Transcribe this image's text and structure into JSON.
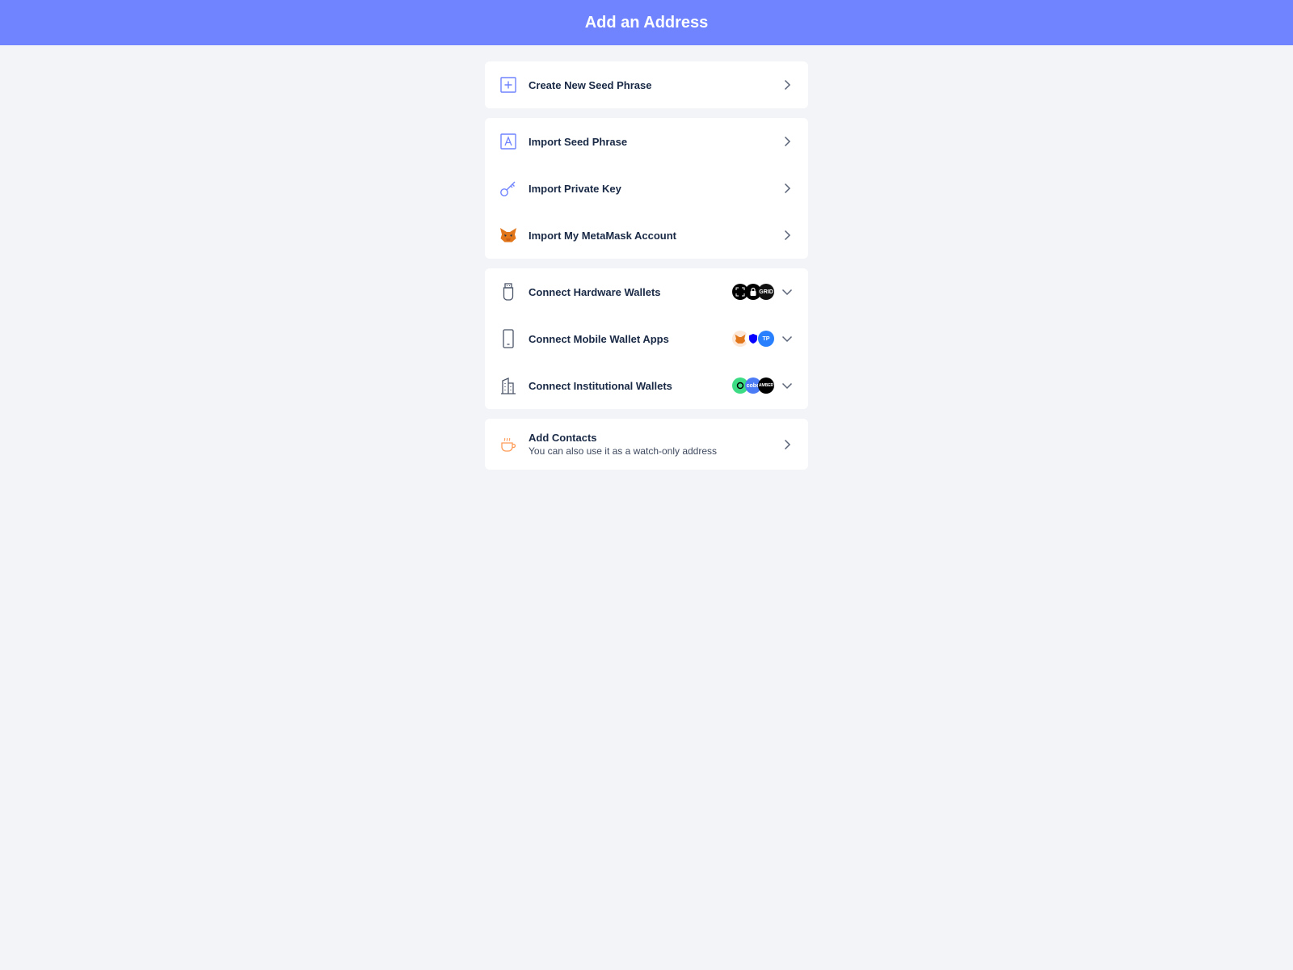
{
  "header": {
    "title": "Add an Address"
  },
  "colors": {
    "accent": "#7084ff",
    "background": "#f2f4f8",
    "text": "#192945",
    "icon_orange": "#ff9b56"
  },
  "groups": [
    {
      "items": [
        {
          "label": "Create New Seed Phrase",
          "icon": "plus-square-icon",
          "action": "chevron-right"
        }
      ]
    },
    {
      "items": [
        {
          "label": "Import Seed Phrase",
          "icon": "letter-a-icon",
          "action": "chevron-right"
        },
        {
          "label": "Import Private Key",
          "icon": "key-icon",
          "action": "chevron-right"
        },
        {
          "label": "Import My MetaMask Account",
          "icon": "metamask-fox-icon",
          "action": "chevron-right"
        }
      ]
    },
    {
      "items": [
        {
          "label": "Connect Hardware Wallets",
          "icon": "usb-device-icon",
          "action": "chevron-down",
          "logos": [
            {
              "icon": "ledger-logo",
              "color": "#000000",
              "text": ""
            },
            {
              "icon": "lock-logo",
              "color": "#000000",
              "text": ""
            },
            {
              "icon": "gridplus-logo",
              "color": "#111111",
              "text": "GRID"
            }
          ]
        },
        {
          "label": "Connect Mobile Wallet Apps",
          "icon": "smartphone-icon",
          "action": "chevron-down",
          "logos": [
            {
              "icon": "metamask-logo",
              "color": "#fde8d7",
              "text": ""
            },
            {
              "icon": "trust-shield-logo",
              "color": "#ffffff",
              "text": ""
            },
            {
              "icon": "tokenpocket-logo",
              "color": "#2980fe",
              "text": "TP"
            }
          ]
        },
        {
          "label": "Connect Institutional Wallets",
          "icon": "buildings-icon",
          "action": "chevron-down",
          "logos": [
            {
              "icon": "mpc-logo",
              "color": "#3ddc84",
              "text": ""
            },
            {
              "icon": "cobo-logo",
              "color": "#4b7bf5",
              "text": "cobo"
            },
            {
              "icon": "amber-logo",
              "color": "#000000",
              "text": "AMBER"
            }
          ]
        }
      ]
    },
    {
      "items": [
        {
          "label": "Add Contacts",
          "sub": "You can also use it as a watch-only address",
          "icon": "coffee-cup-icon",
          "action": "chevron-right"
        }
      ]
    }
  ]
}
